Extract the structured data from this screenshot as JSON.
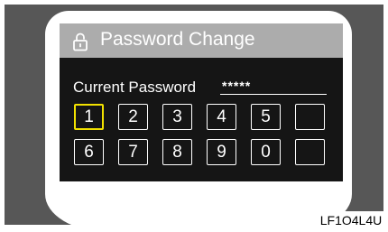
{
  "dialog": {
    "title": "Password Change",
    "title_icon": "lock-icon"
  },
  "password": {
    "label": "Current Password",
    "value": "*****"
  },
  "keypad": {
    "selected_key": "1",
    "row1": [
      "1",
      "2",
      "3",
      "4",
      "5",
      ""
    ],
    "row2": [
      "6",
      "7",
      "8",
      "9",
      "0",
      ""
    ]
  },
  "figure_code": "LF1O4L4U",
  "colors": {
    "frame": "#575757",
    "screen": "#151515",
    "title_bar": "#acacac",
    "selection": "#f2e100"
  }
}
